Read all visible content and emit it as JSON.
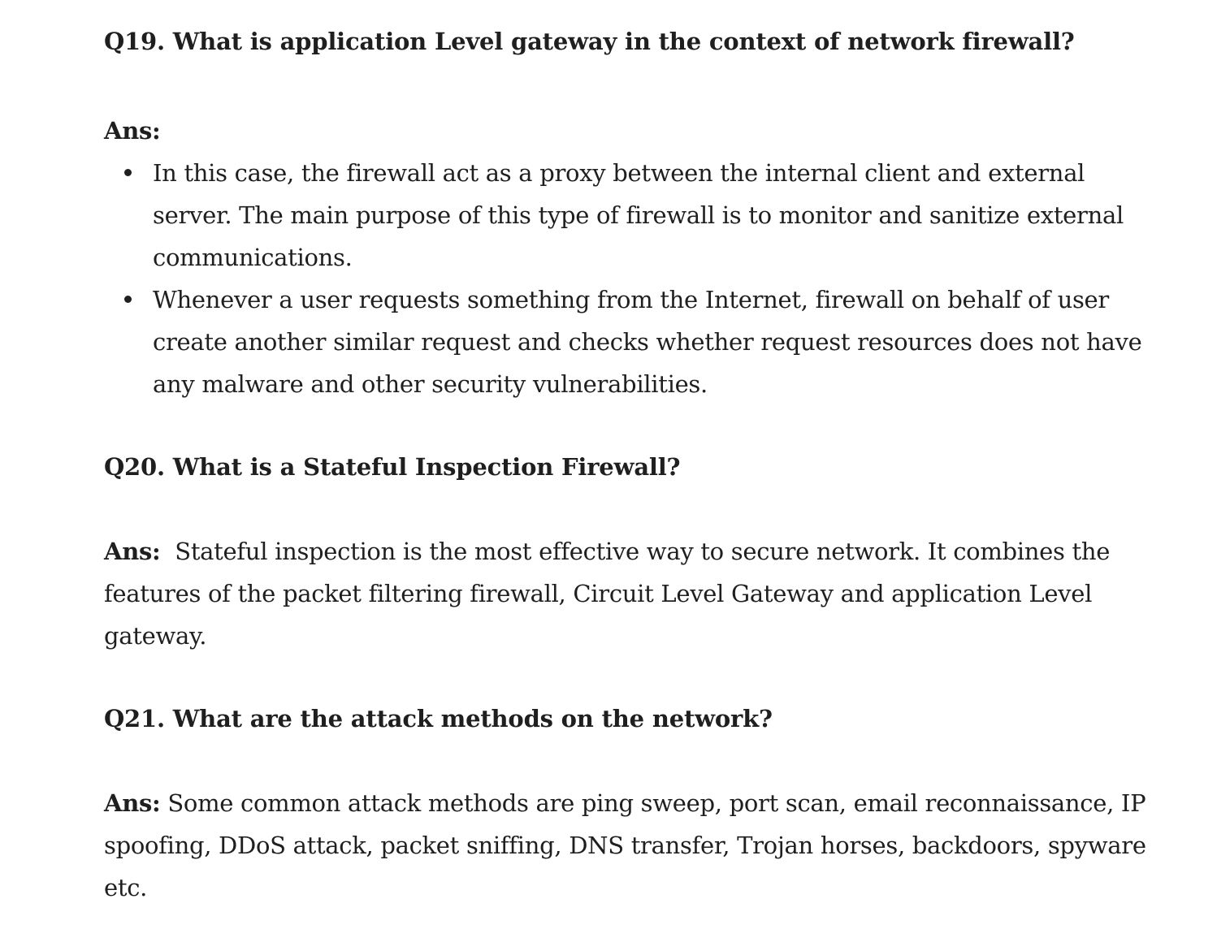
{
  "sections": [
    {
      "question": "Q19. What is application Level gateway in the context of network firewall?",
      "ans_label": "Ans:",
      "bullets": [
        "In this case, the firewall act as a proxy between the internal client and external server. The main purpose of this type of firewall is to monitor and sanitize external communications.",
        "Whenever a user requests something from the Internet, firewall on behalf of user create another similar request and checks whether request resources does not have any malware and other security vulnerabilities."
      ]
    },
    {
      "question": "Q20. What is a Stateful Inspection Firewall?",
      "ans_label": "Ans:",
      "answer": "Stateful inspection is the most effective way to secure network. It combines the features of the packet filtering firewall, Circuit Level Gateway and application Level gateway."
    },
    {
      "question": "Q21. What are the attack methods on the network?",
      "ans_label": "Ans:",
      "answer": "Some common attack methods are ping sweep, port scan, email reconnaissance, IP spoofing, DDoS attack, packet sniffing, DNS transfer, Trojan horses, backdoors, spyware etc."
    }
  ]
}
